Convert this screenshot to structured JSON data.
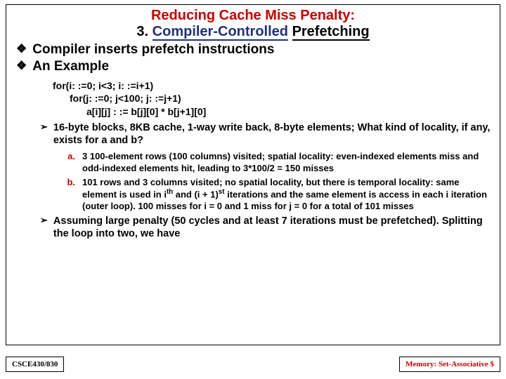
{
  "title": {
    "line1": "Reducing Cache Miss Penalty:",
    "line2_prefix": "3.",
    "line2_main": "Compiler-Controlled",
    "line2_suffix": "Prefetching"
  },
  "diamond": [
    "Compiler inserts prefetch instructions",
    "An Example"
  ],
  "code": {
    "l1": "for(i: :=0; i<3; i: :=i+1)",
    "l2": "for(j: :=0; j<100; j: :=j+1)",
    "l3": "a[i][j] : := b[j][0] * b[j+1][0]"
  },
  "chev1": "16-byte blocks, 8KB cache, 1-way write back, 8-byte elements; What kind of locality, if any, exists for a and b?",
  "alpha": {
    "a_marker": "a.",
    "a_text": "3 100-element rows (100 columns) visited; spatial locality: even-indexed elements miss and odd-indexed elements hit, leading to  3*100/2 = 150 misses",
    "b_marker": "b.",
    "b_text_before": "101 rows and 3 columns visited; no spatial locality, but there is temporal locality: same element is used in i",
    "b_text_mid": " and (i + 1)",
    "b_text_after": " iterations and the same element is access in each i iteration (outer loop). 100 misses for i = 0 and 1 miss for j = 0 for a total of 101 misses"
  },
  "chev2": "Assuming large penalty (50 cycles and at least 7 iterations must be prefetched). Splitting the loop into two, we have",
  "footer": {
    "left": "CSCE430/830",
    "right": "Memory: Set-Associative $"
  }
}
